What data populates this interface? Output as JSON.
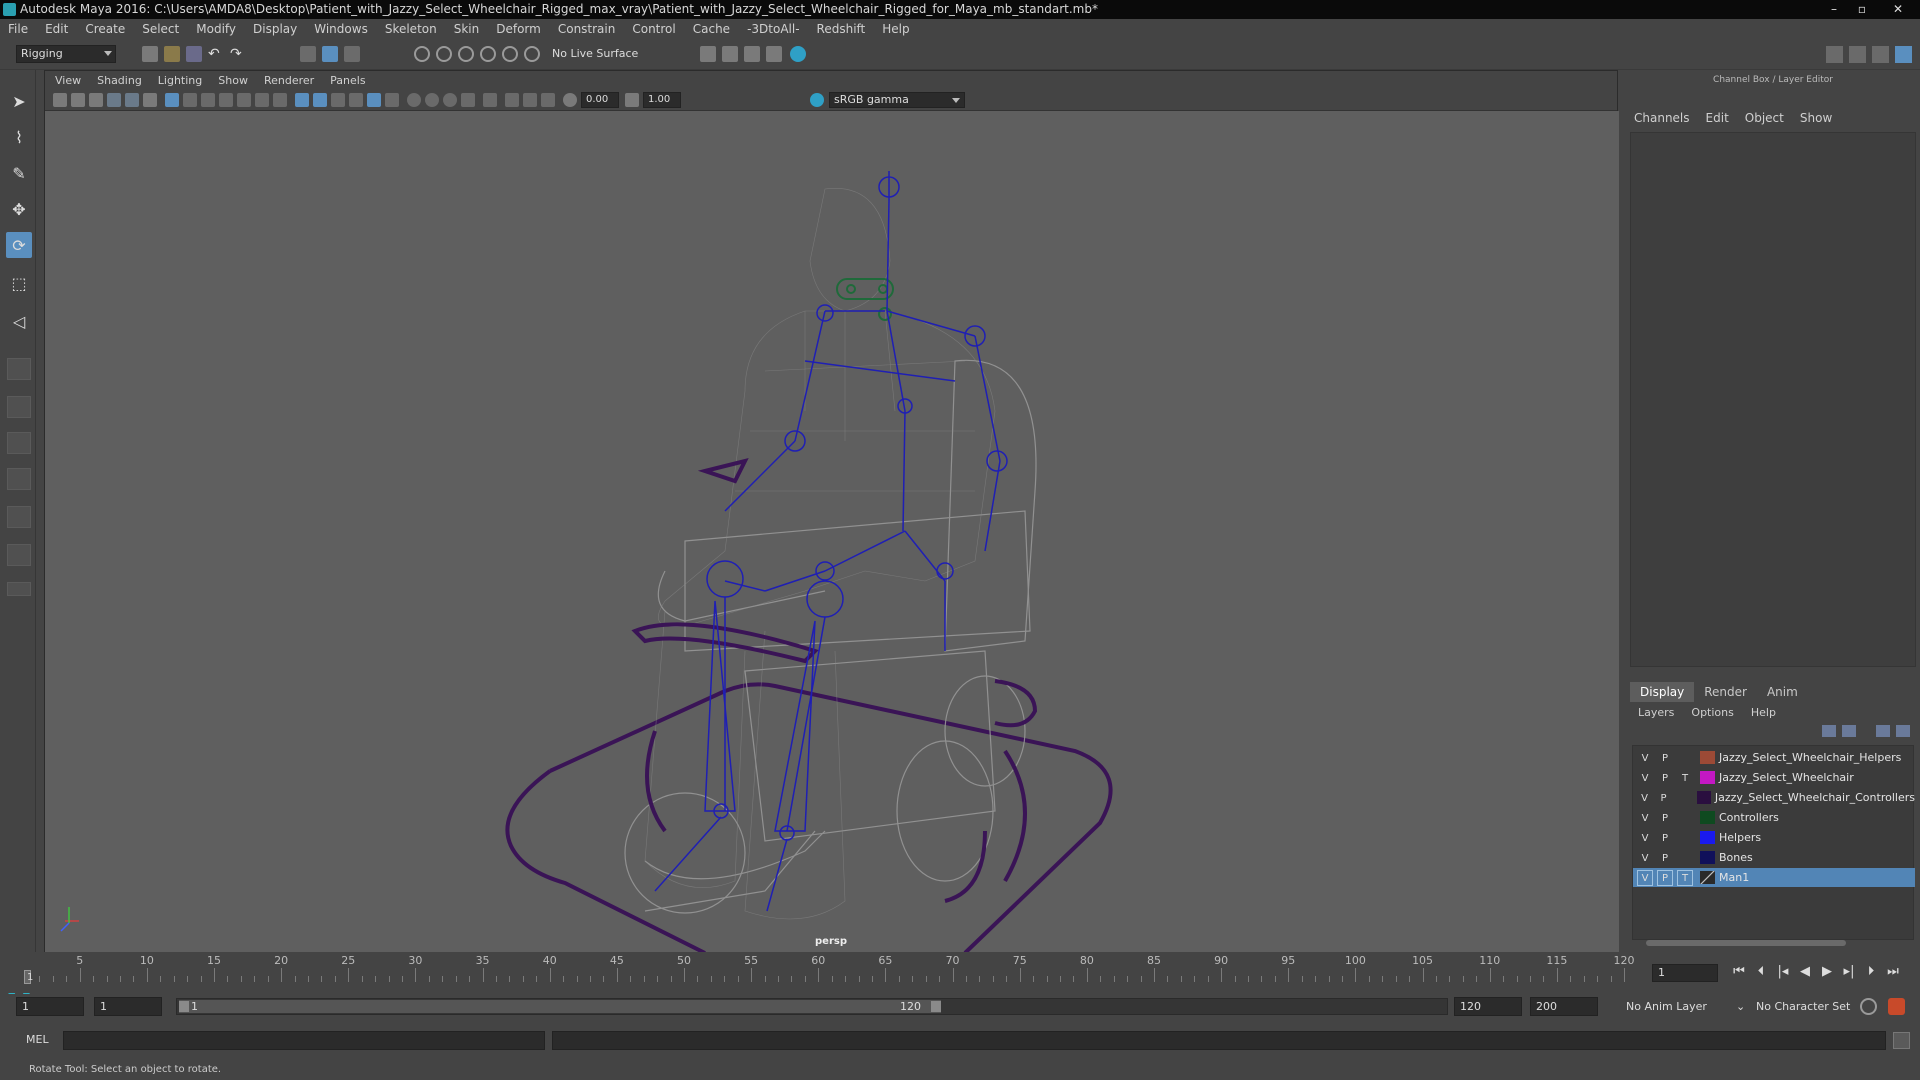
{
  "window": {
    "title": "Autodesk Maya 2016: C:\\Users\\AMDA8\\Desktop\\Patient_with_Jazzy_Select_Wheelchair_Rigged_max_vray\\Patient_with_Jazzy_Select_Wheelchair_Rigged_for_Maya_mb_standart.mb*",
    "minimize": "–",
    "maximize": "▫",
    "close": "✕"
  },
  "menu": [
    "File",
    "Edit",
    "Create",
    "Select",
    "Modify",
    "Display",
    "Windows",
    "Skeleton",
    "Skin",
    "Deform",
    "Constrain",
    "Control",
    "Cache",
    "-3DtoAll-",
    "Redshift",
    "Help"
  ],
  "statusline": {
    "mode": "Rigging",
    "live_surface": "No Live Surface"
  },
  "viewport": {
    "menu": [
      "View",
      "Shading",
      "Lighting",
      "Show",
      "Renderer",
      "Panels"
    ],
    "exposure": "0.00",
    "gamma": "1.00",
    "color_space": "sRGB gamma",
    "camera": "persp"
  },
  "right_panel": {
    "title": "Channel Box / Layer Editor",
    "menu": [
      "Channels",
      "Edit",
      "Object",
      "Show"
    ],
    "tabs": [
      "Display",
      "Render",
      "Anim"
    ],
    "active_tab": "Display",
    "layer_menu": [
      "Layers",
      "Options",
      "Help"
    ],
    "layers": [
      {
        "v": "V",
        "p": "P",
        "t": "",
        "color": "#9c4a36",
        "name": "Jazzy_Select_Wheelchair_Helpers",
        "selected": false
      },
      {
        "v": "V",
        "p": "P",
        "t": "T",
        "color": "#c418c4",
        "name": "Jazzy_Select_Wheelchair",
        "selected": false
      },
      {
        "v": "V",
        "p": "P",
        "t": "",
        "color": "#2a0f3f",
        "name": "Jazzy_Select_Wheelchair_Controllers",
        "selected": false
      },
      {
        "v": "V",
        "p": "P",
        "t": "",
        "color": "#0f4a20",
        "name": "Controllers",
        "selected": false
      },
      {
        "v": "V",
        "p": "P",
        "t": "",
        "color": "#1a1aee",
        "name": "Helpers",
        "selected": false
      },
      {
        "v": "V",
        "p": "P",
        "t": "",
        "color": "#10105a",
        "name": "Bones",
        "selected": false
      },
      {
        "v": "V",
        "p": "P",
        "t": "T",
        "color": "#2a2a2a",
        "name": "Man1",
        "selected": true
      }
    ]
  },
  "timeline": {
    "ticks": [
      "5",
      "10",
      "15",
      "20",
      "25",
      "30",
      "35",
      "40",
      "45",
      "50",
      "55",
      "60",
      "65",
      "70",
      "75",
      "80",
      "85",
      "90",
      "95",
      "100",
      "105",
      "110",
      "115",
      "120"
    ],
    "start": 1,
    "end": 120,
    "current": "1",
    "current_frame_field": "1"
  },
  "range": {
    "start_field": "1",
    "start_field2": "1",
    "playback_start": "1",
    "playback_end": "120",
    "end_field": "120",
    "end_field2": "200",
    "anim_layer": "No Anim Layer",
    "character_set": "No Character Set"
  },
  "command": {
    "label": "MEL"
  },
  "help": "Rotate Tool: Select an object to rotate.",
  "colors": {
    "accent": "#5285b6",
    "joint": "#1f1fb4",
    "control": "#3a1456",
    "mesh": "#9a9a9a"
  }
}
